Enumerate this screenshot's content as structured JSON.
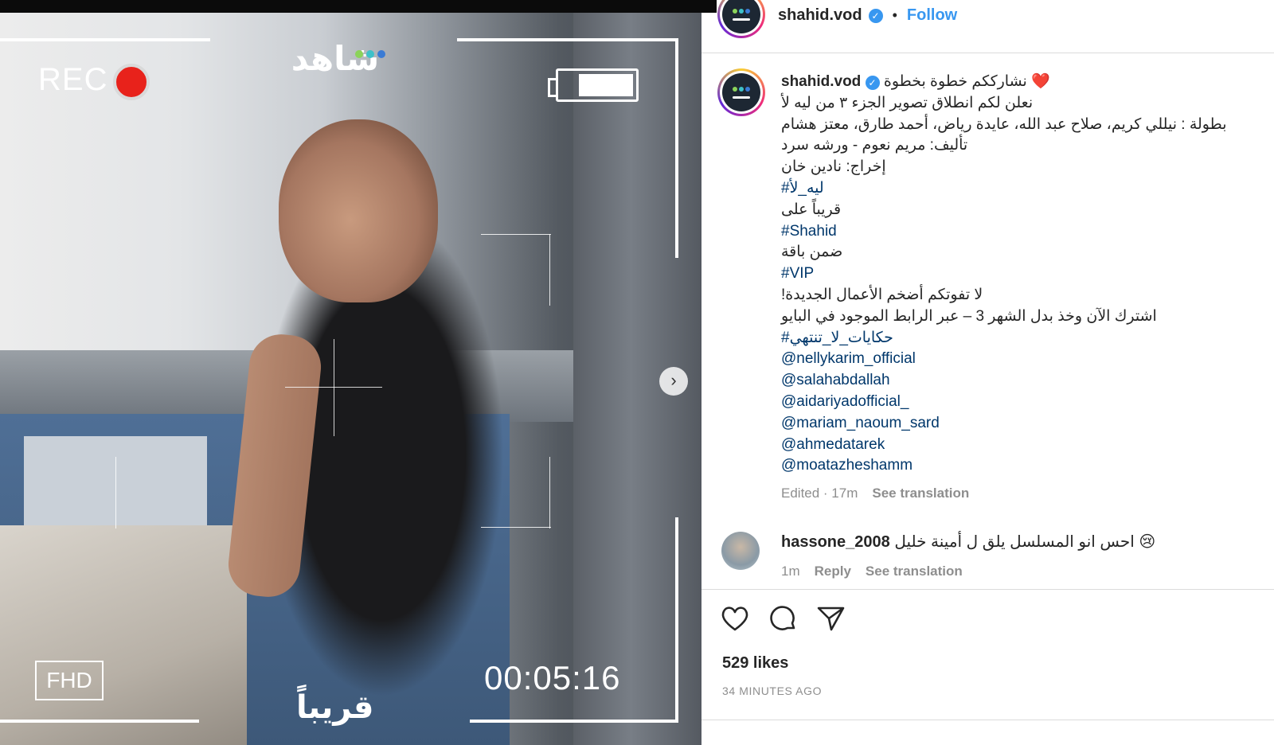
{
  "media": {
    "rec_label": "REC",
    "logo_text": "شاهد",
    "logo_dot_colors": [
      "#8bd35a",
      "#3ec1c9",
      "#3a7bd5"
    ],
    "fhd_label": "FHD",
    "timecode": "00:05:16",
    "soon_text": "قريباً",
    "next_icon": "chevron-right-icon"
  },
  "post": {
    "username": "shahid.vod",
    "follow_label": "Follow",
    "verified_icon": "verified-badge-icon",
    "caption": {
      "first_line": "نشارككم خطوة بخطوة ❤️",
      "lines": [
        {
          "text": "نعلن لكم انطلاق تصوير الجزء ٣ من ليه لأ",
          "type": "text"
        },
        {
          "text": "بطولة : نيللي كريم، صلاح عبد الله، عايدة رياض، أحمد طارق، معتز هشام",
          "type": "text"
        },
        {
          "text": "تأليف: مريم نعوم - ورشه سرد",
          "type": "text"
        },
        {
          "text": "إخراج: نادين خان",
          "type": "text"
        },
        {
          "text": "#ليه_لأ",
          "type": "link"
        },
        {
          "text": "قريباً على",
          "type": "text"
        },
        {
          "text": "#Shahid",
          "type": "link"
        },
        {
          "text": "ضمن باقة",
          "type": "text"
        },
        {
          "text": "#VIP",
          "type": "link"
        },
        {
          "text": "لا تفوتكم أضخم الأعمال الجديدة!",
          "type": "text"
        },
        {
          "text": "اشترك الآن وخذ بدل الشهر 3 – عبر الرابط الموجود في البايو",
          "type": "text"
        },
        {
          "text": "#حكايات_لا_تنتهي",
          "type": "link"
        },
        {
          "text": "@nellykarim_official",
          "type": "link"
        },
        {
          "text": "@salahabdallah",
          "type": "link"
        },
        {
          "text": "@aidariyadofficial_",
          "type": "link"
        },
        {
          "text": "@mariam_naoum_sard",
          "type": "link"
        },
        {
          "text": "@ahmedatarek",
          "type": "link"
        },
        {
          "text": "@moatazheshamm",
          "type": "link"
        }
      ]
    },
    "edited_label": "Edited · 17m",
    "see_translation": "See translation",
    "comment": {
      "username": "hassone_2008",
      "text": "احس انو المسلسل يلق ل أمينة خليل 😢",
      "time": "1m",
      "reply_label": "Reply",
      "see_translation": "See translation"
    },
    "actions": [
      "heart-icon",
      "comment-icon",
      "share-icon"
    ],
    "likes": "529 likes",
    "time_ago": "34 MINUTES AGO"
  },
  "colors": {
    "link": "#00376b",
    "follow": "#3897f0",
    "rec_dot": "#e8221b",
    "muted": "#8e8e8e"
  }
}
